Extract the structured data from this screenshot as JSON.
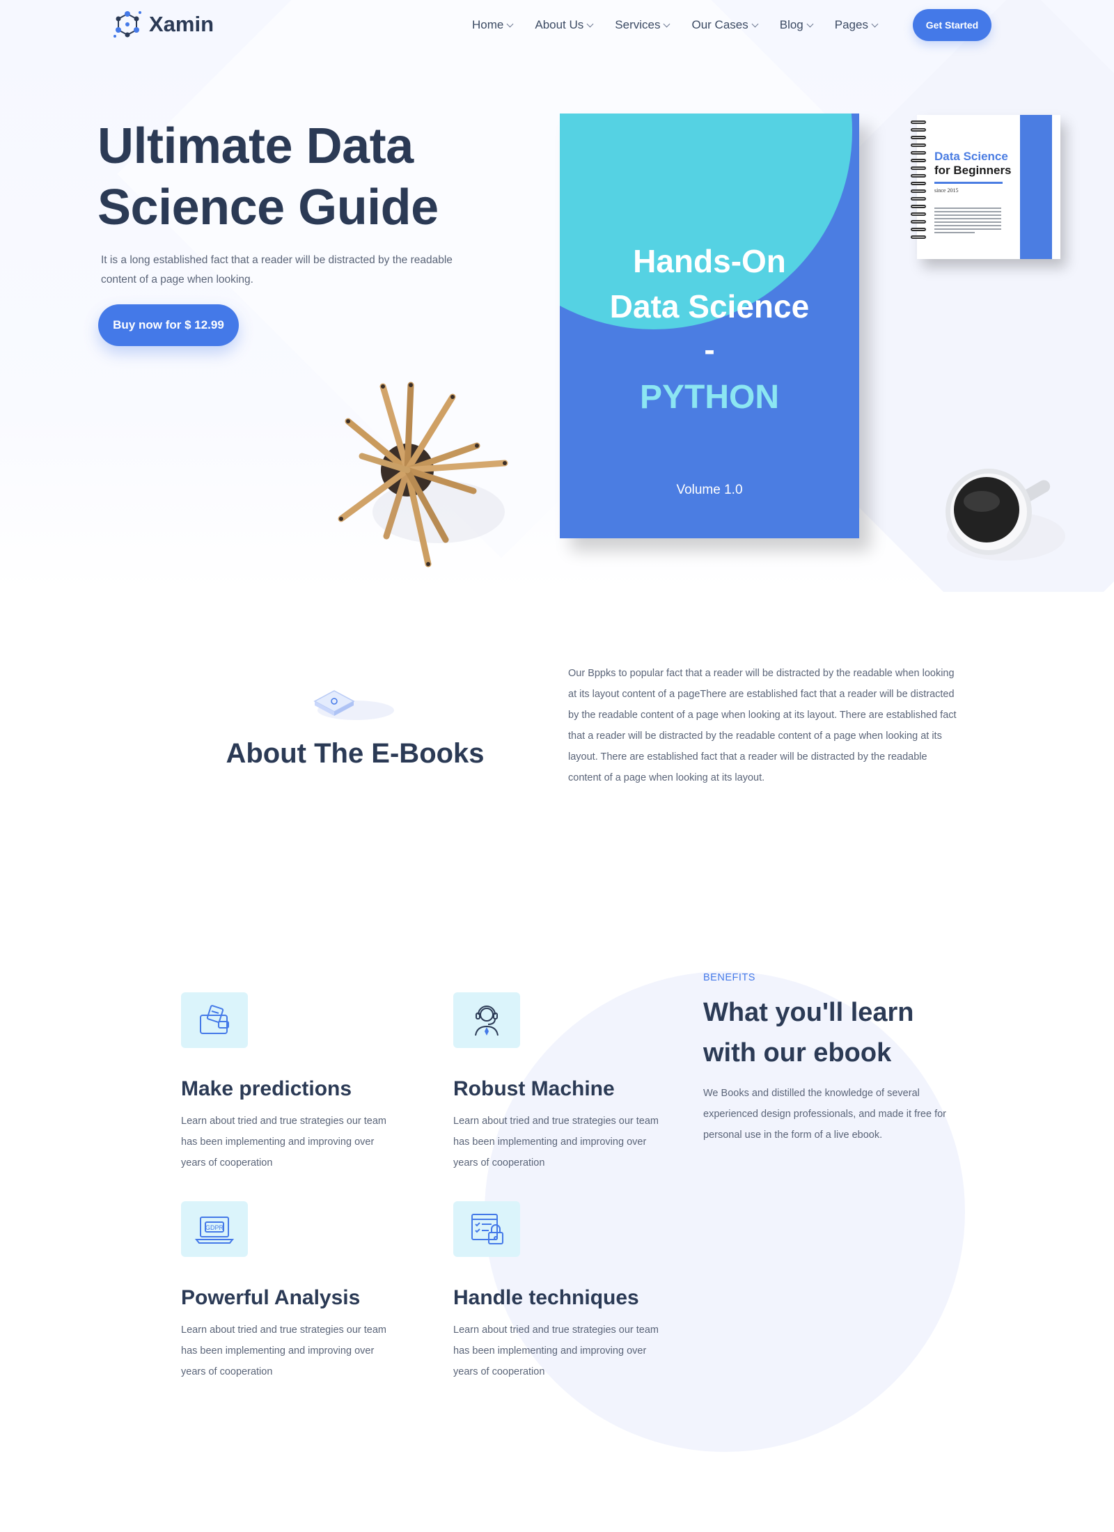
{
  "header": {
    "logo_text": "Xamin",
    "nav": [
      {
        "label": "Home"
      },
      {
        "label": "About Us"
      },
      {
        "label": "Services"
      },
      {
        "label": "Our Cases"
      },
      {
        "label": "Blog"
      },
      {
        "label": "Pages"
      }
    ],
    "cta_label": "Get Started"
  },
  "hero": {
    "title": "Ultimate Data Science Guide",
    "description": "It is a long established fact that a reader will be distracted by the readable content of a page when looking.",
    "buy_label": "Buy now for $ 12.99",
    "book": {
      "line1": "Hands-On",
      "line2": "Data Science",
      "line3": "-",
      "line4": "PYTHON",
      "volume": "Volume 1.0"
    },
    "notebook": {
      "title1": "Data Science",
      "title2": "for Beginners",
      "since": "since 2015"
    }
  },
  "about": {
    "title": "About The E-Books",
    "text": "Our Bppks to popular fact that a reader will be distracted by the readable when looking at its layout content of a pageThere are established fact that a reader will be distracted by the readable content of a page when looking at its layout. There are established fact that a reader will be distracted by the readable content of a page when looking at its layout. There are established fact that a reader will be distracted by the readable content of a page when looking at its layout."
  },
  "benefits": {
    "kicker": "BENEFITS",
    "title": "What you'll learn with our ebook",
    "description": "We Books and distilled the knowledge of several experienced design professionals, and made it free for personal use in the form of a live ebook.",
    "features": [
      {
        "title": "Make predictions",
        "text": "Learn about tried and true strategies our team has been implementing and improving over years of cooperation",
        "icon": "wallet-icon"
      },
      {
        "title": "Robust Machine",
        "text": "Learn about tried and true strategies our team has been implementing and improving over years of cooperation",
        "icon": "support-agent-icon"
      },
      {
        "title": "Powerful Analysis",
        "text": "Learn about tried and true strategies our team has been implementing and improving over years of cooperation",
        "icon": "gdpr-laptop-icon"
      },
      {
        "title": "Handle techniques",
        "text": "Learn about tried and true strategies our team has been implementing and improving over years of cooperation",
        "icon": "checklist-lock-icon"
      }
    ]
  },
  "colors": {
    "accent": "#4479e8",
    "heading": "#2b3a55",
    "book": "#4b7de2",
    "book_circle": "#55d2e3",
    "icon_bg": "#dbf4fb"
  }
}
